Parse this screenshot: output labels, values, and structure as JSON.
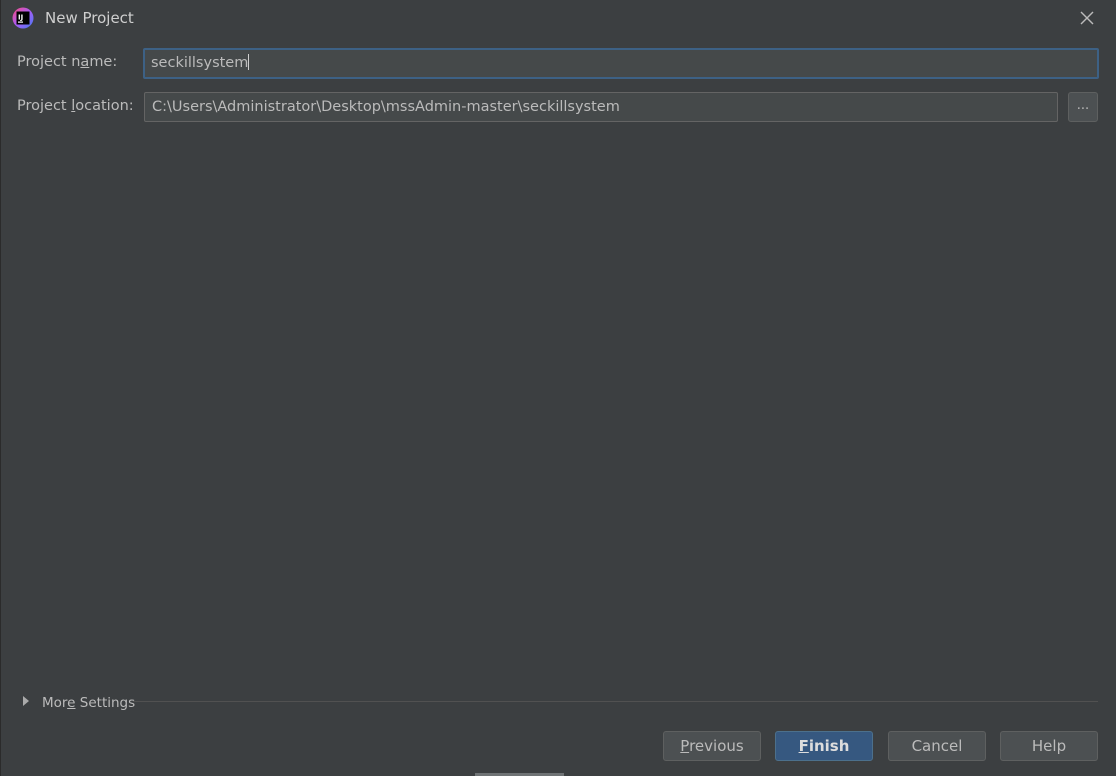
{
  "window": {
    "title": "New Project",
    "icon": "intellij-idea-icon",
    "close_icon": "close-icon"
  },
  "form": {
    "project_name": {
      "label_pre": "Project n",
      "label_mnemonic": "a",
      "label_post": "me:",
      "value": "seckillsystem"
    },
    "project_location": {
      "label_pre": "Project ",
      "label_mnemonic": "l",
      "label_post": "ocation:",
      "value": "C:\\Users\\Administrator\\Desktop\\mssAdmin-master\\seckillsystem",
      "browse_label": "..."
    }
  },
  "more_settings": {
    "label_pre": "Mor",
    "label_mnemonic": "e",
    "label_post": " Settings",
    "expanded": false
  },
  "buttons": {
    "previous": {
      "mnemonic": "P",
      "rest": "revious"
    },
    "finish": {
      "mnemonic": "F",
      "rest": "inish"
    },
    "cancel": {
      "label": "Cancel"
    },
    "help": {
      "label": "Help"
    }
  },
  "colors": {
    "background": "#3c3f41",
    "focus_border": "#3d6185",
    "primary_button": "#365880"
  }
}
